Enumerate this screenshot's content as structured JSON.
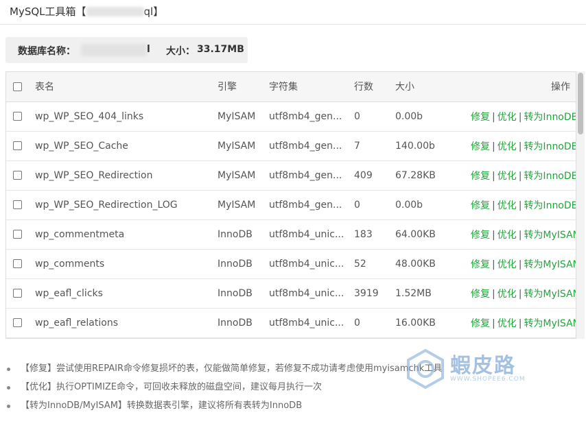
{
  "window": {
    "title_prefix": "MySQL工具箱【",
    "title_fragment": "ql】"
  },
  "dbinfo": {
    "name_label": "数据库名称：",
    "name_fragment": "l",
    "size_label": "大小：",
    "size_value": "33.17MB"
  },
  "table": {
    "headers": [
      "表名",
      "引擎",
      "字符集",
      "行数",
      "大小",
      "操作"
    ],
    "rows": [
      {
        "name": "wp_WP_SEO_404_links",
        "engine": "MyISAM",
        "charset": "utf8mb4_gen...",
        "rows": "0",
        "size": "0.00b",
        "convert": "转为InnoDB"
      },
      {
        "name": "wp_WP_SEO_Cache",
        "engine": "MyISAM",
        "charset": "utf8mb4_gen...",
        "rows": "7",
        "size": "140.00b",
        "convert": "转为InnoDB"
      },
      {
        "name": "wp_WP_SEO_Redirection",
        "engine": "MyISAM",
        "charset": "utf8mb4_gen...",
        "rows": "409",
        "size": "67.28KB",
        "convert": "转为InnoDB"
      },
      {
        "name": "wp_WP_SEO_Redirection_LOG",
        "engine": "MyISAM",
        "charset": "utf8mb4_gen...",
        "rows": "0",
        "size": "0.00b",
        "convert": "转为InnoDB"
      },
      {
        "name": "wp_commentmeta",
        "engine": "InnoDB",
        "charset": "utf8mb4_unic...",
        "rows": "183",
        "size": "64.00KB",
        "convert": "转为MyISAM"
      },
      {
        "name": "wp_comments",
        "engine": "InnoDB",
        "charset": "utf8mb4_unic...",
        "rows": "52",
        "size": "48.00KB",
        "convert": "转为MyISAM"
      },
      {
        "name": "wp_eafl_clicks",
        "engine": "InnoDB",
        "charset": "utf8mb4_unic...",
        "rows": "3919",
        "size": "1.52MB",
        "convert": "转为MyISAM"
      },
      {
        "name": "wp_eafl_relations",
        "engine": "InnoDB",
        "charset": "utf8mb4_unic...",
        "rows": "0",
        "size": "16.00KB",
        "convert": "转为MyISAM"
      }
    ],
    "repair_label": "修复",
    "optimize_label": "优化",
    "separator": "|"
  },
  "notes": [
    "【修复】尝试使用REPAIR命令修复损坏的表，仅能做简单修复，若修复不成功请考虑使用myisamchk工具",
    "【优化】执行OPTIMIZE命令，可回收未释放的磁盘空间，建议每月执行一次",
    "【转为InnoDB/MyISAM】转换数据表引擎，建议将所有表转为InnoDB"
  ],
  "watermark": {
    "text": "蝦皮路",
    "url": "WWW.SHOPEE6.COM"
  },
  "colors": {
    "link": "#20a53a",
    "header_bg": "#f6f6f6",
    "info_bg": "#f0f0f0"
  }
}
